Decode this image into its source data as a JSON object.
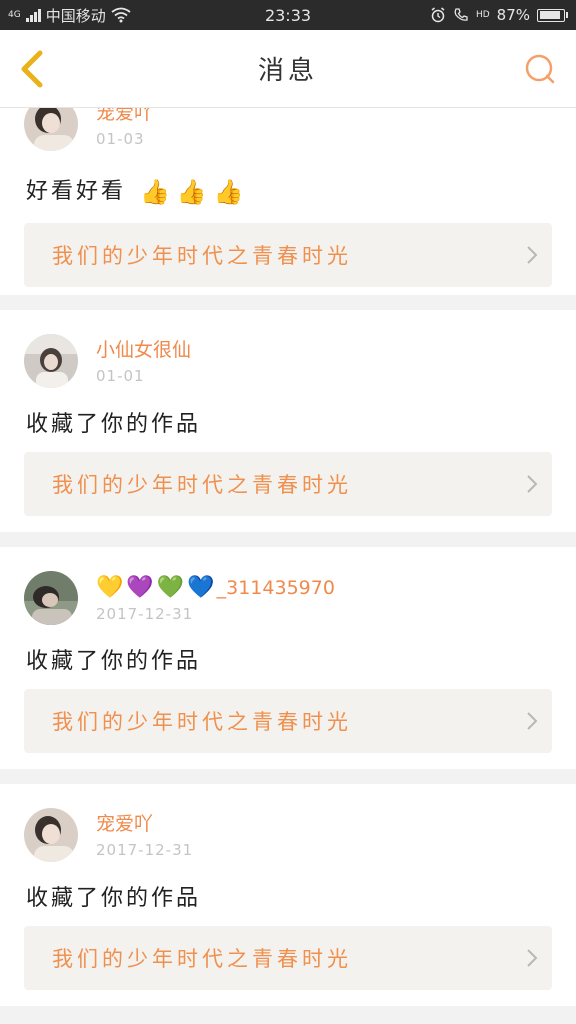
{
  "status_bar": {
    "network_tag": "4G",
    "carrier": "中国移动",
    "time": "23:33",
    "hd_tag": "HD",
    "battery": "87%",
    "battery_level": 0.87
  },
  "header": {
    "title": "消息",
    "back_icon": "chevron-left-icon",
    "search_icon": "search-icon",
    "accent_color": "#f08a4b"
  },
  "feed": [
    {
      "username": "宠爱吖",
      "date": "01-03",
      "message": "好看好看",
      "emoji": [
        "👍",
        "👍",
        "👍"
      ],
      "work_title": "我们的少年时代之青春时光"
    },
    {
      "username": "小仙女很仙",
      "date": "01-01",
      "message": "收藏了你的作品",
      "work_title": "我们的少年时代之青春时光"
    },
    {
      "username": "_311435970",
      "username_hearts": [
        "💛",
        "💜",
        "💚",
        "💙"
      ],
      "date": "2017-12-31",
      "message": "收藏了你的作品",
      "work_title": "我们的少年时代之青春时光"
    },
    {
      "username": "宠爱吖",
      "date": "2017-12-31",
      "message": "收藏了你的作品",
      "work_title": "我们的少年时代之青春时光"
    }
  ]
}
